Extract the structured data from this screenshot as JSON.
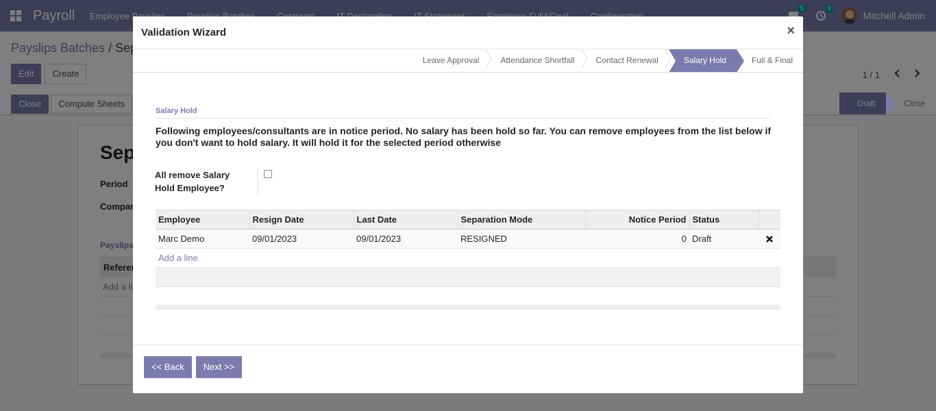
{
  "navbar": {
    "brand": "Payroll",
    "menu": [
      "Employee Payslips",
      "Payslips Batches",
      "Contracts",
      "IT Declaration",
      "IT Statement",
      "Employee Full&Final",
      "Configuration"
    ],
    "messages_count": "5",
    "activities_count": "9",
    "user_name": "Mitchell Admin"
  },
  "breadcrumb": {
    "parent": "Payslips Batches",
    "separator": " / ",
    "current": "Sep"
  },
  "control": {
    "edit_label": "Edit",
    "create_label": "Create",
    "pager_text": "1 / 1"
  },
  "statusbar": {
    "close_label": "Close",
    "compute_label": "Compute Sheets",
    "states": [
      "Draft",
      "Close"
    ],
    "active_state": "Draft"
  },
  "sheet": {
    "title": "Sep",
    "period_label": "Period",
    "company_label": "Compar",
    "tab_label": "Payslips",
    "table_header": "Referen",
    "add_line": "Add a li"
  },
  "modal": {
    "title": "Validation Wizard",
    "close_symbol": "×",
    "steps": [
      "Leave Approval",
      "Attendance Shortfall",
      "Contact Renewal",
      "Salary Hold",
      "Full & Final"
    ],
    "active_step": "Salary Hold",
    "section_title": "Salary Hold",
    "message": "Following employees/consultants are in notice period. No salary has been hold so far. You can remove employees from the list below if you don't want to hold salary. It will hold it for the selected period otherwise",
    "checkbox_label": "All remove Salary Hold Employee?",
    "checkbox_checked": false,
    "table": {
      "columns": [
        "Employee",
        "Resign Date",
        "Last Date",
        "Separation Mode",
        "Notice Period",
        "Status"
      ],
      "rows": [
        {
          "employee": "Marc Demo",
          "resign_date": "09/01/2023",
          "last_date": "09/01/2023",
          "separation_mode": "RESIGNED",
          "notice_period": "0",
          "status": "Draft"
        }
      ],
      "add_line": "Add a line"
    },
    "back_label": "<< Back",
    "next_label": "Next >>"
  },
  "colors": {
    "primary": "#7c7bad",
    "backdrop": "rgba(0,0,0,0.5)"
  }
}
